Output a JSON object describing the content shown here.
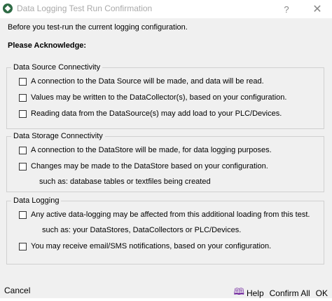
{
  "window": {
    "title": "Data Logging Test Run Confirmation",
    "help_glyph": "?",
    "close_glyph": "✕"
  },
  "intro": "Before you test-run the current logging configuration.",
  "acknowledge": "Please Acknowledge:",
  "groups": {
    "source": {
      "title": "Data Source Connectivity",
      "items": [
        "A connection to the Data Source will be made, and data will be read.",
        "Values may be written to the DataCollector(s), based on your configuration.",
        "Reading data from the DataSource(s) may add load to your PLC/Devices."
      ]
    },
    "storage": {
      "title": "Data Storage Connectivity",
      "items": [
        "A connection to the DataStore will be made, for data logging purposes.",
        "Changes may be made to the DataStore based on your configuration."
      ],
      "note": "such as: database tables or textfiles being created"
    },
    "logging": {
      "title": "Data Logging",
      "items": [
        "Any active data-logging may be affected from this additional loading from this test.",
        "You may receive email/SMS notifications, based on your configuration."
      ],
      "note": "such as: your DataStores, DataCollectors or PLC/Devices."
    }
  },
  "footer": {
    "cancel": "Cancel",
    "help": "Help",
    "confirm_all": "Confirm All",
    "ok": "OK"
  }
}
